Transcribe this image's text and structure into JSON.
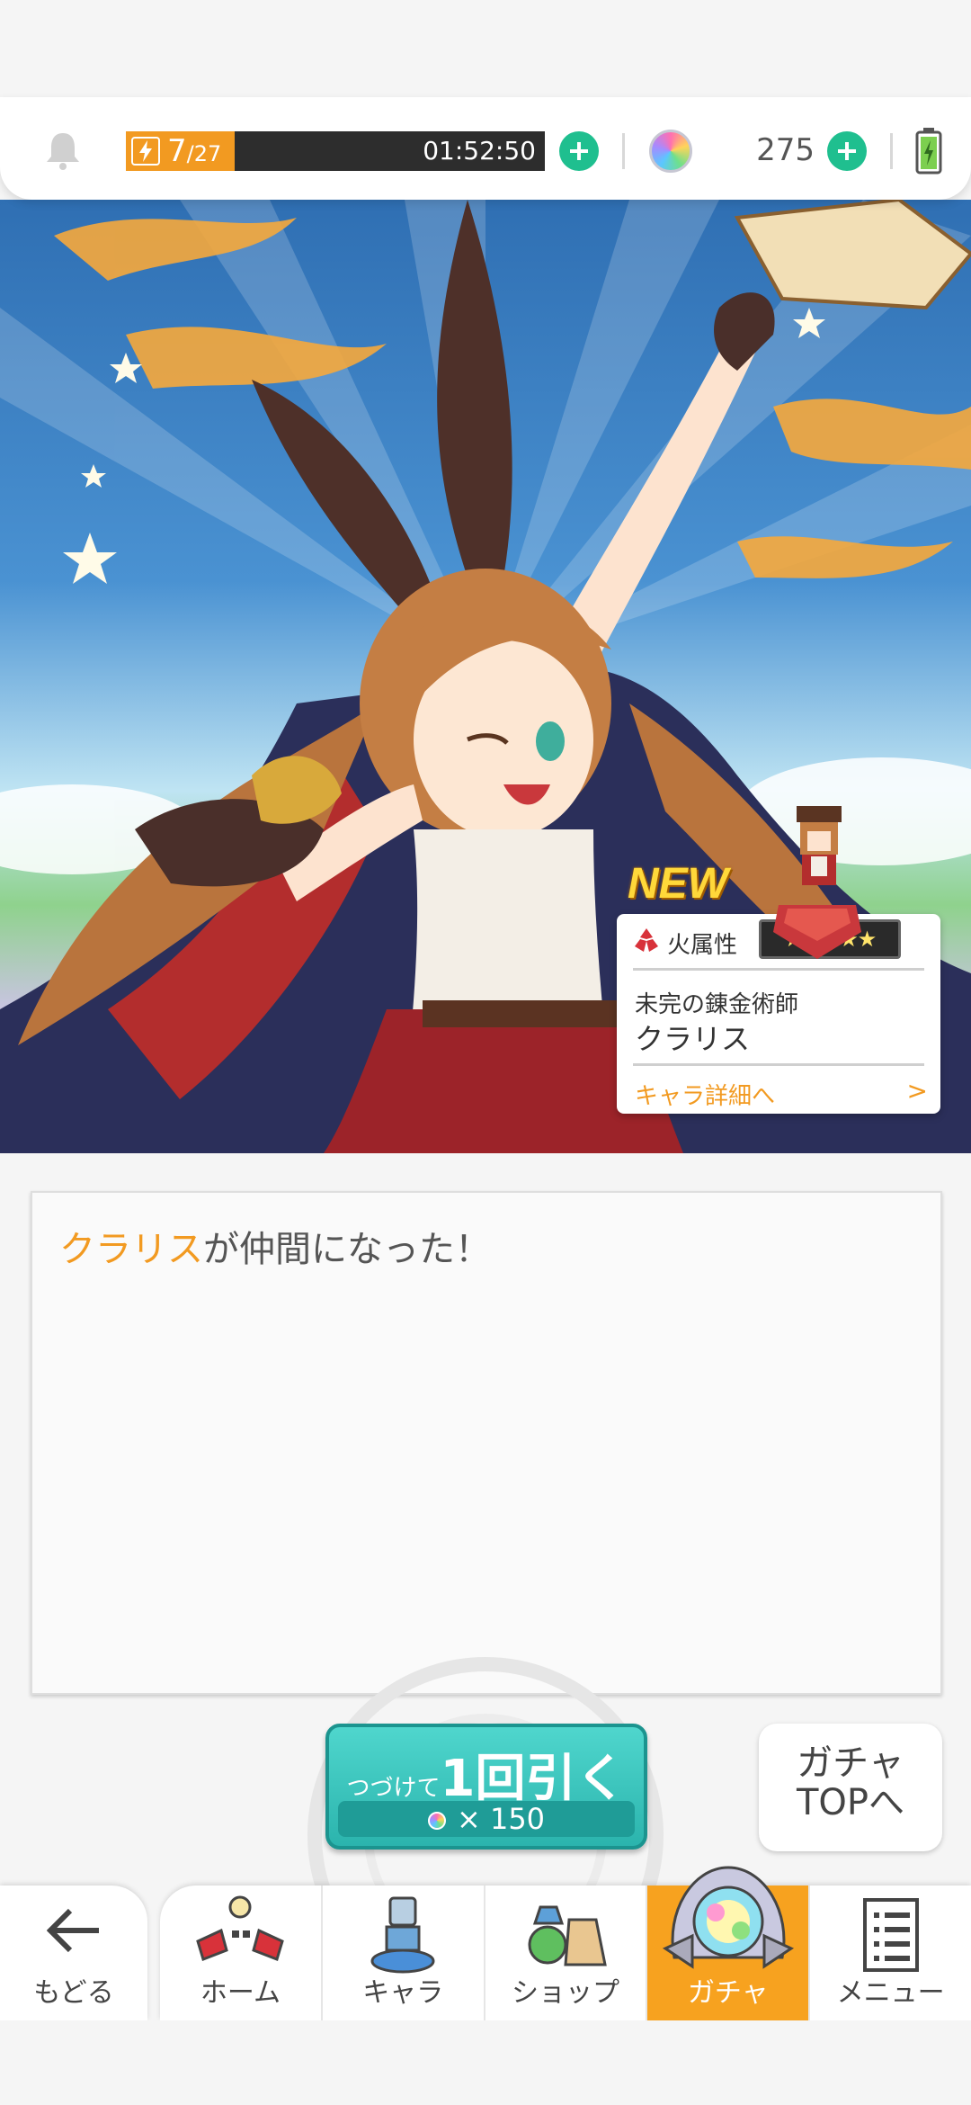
{
  "status_bar": {
    "stamina_current": "7",
    "stamina_max": "/27",
    "stamina_fraction": 0.26,
    "stamina_timer": "01:52:50",
    "gem_count": "275"
  },
  "character_card": {
    "new_badge": "NEW",
    "attribute": "火属性",
    "rarity_stars": "★★★★★",
    "title": "未完の錬金術師",
    "name": "クラリス",
    "detail_link": "キャラ詳細へ",
    "detail_arrow": ">"
  },
  "message": {
    "highlight": "クラリス",
    "rest": "が仲間になった！"
  },
  "pull_button": {
    "prefix": "つづけて",
    "main": "1回引く",
    "cost": "× 150"
  },
  "gacha_top_button": {
    "line1": "ガチャ",
    "line2": "TOPへ"
  },
  "nav": {
    "back": "もどる",
    "items": [
      {
        "label": "ホーム"
      },
      {
        "label": "キャラ"
      },
      {
        "label": "ショップ"
      },
      {
        "label": "ガチャ"
      },
      {
        "label": "メニュー"
      }
    ],
    "active_index": 3
  },
  "colors": {
    "accent_orange": "#f29a21",
    "accent_teal": "#2bb4ad",
    "plus_green": "#1fbf8f"
  },
  "icons": [
    "bell-icon",
    "bolt-icon",
    "plus-icon",
    "gem-icon",
    "battery-icon",
    "fire-attribute-icon",
    "back-arrow-icon",
    "home-icon",
    "chara-icon",
    "shop-icon",
    "gacha-icon",
    "menu-icon"
  ]
}
